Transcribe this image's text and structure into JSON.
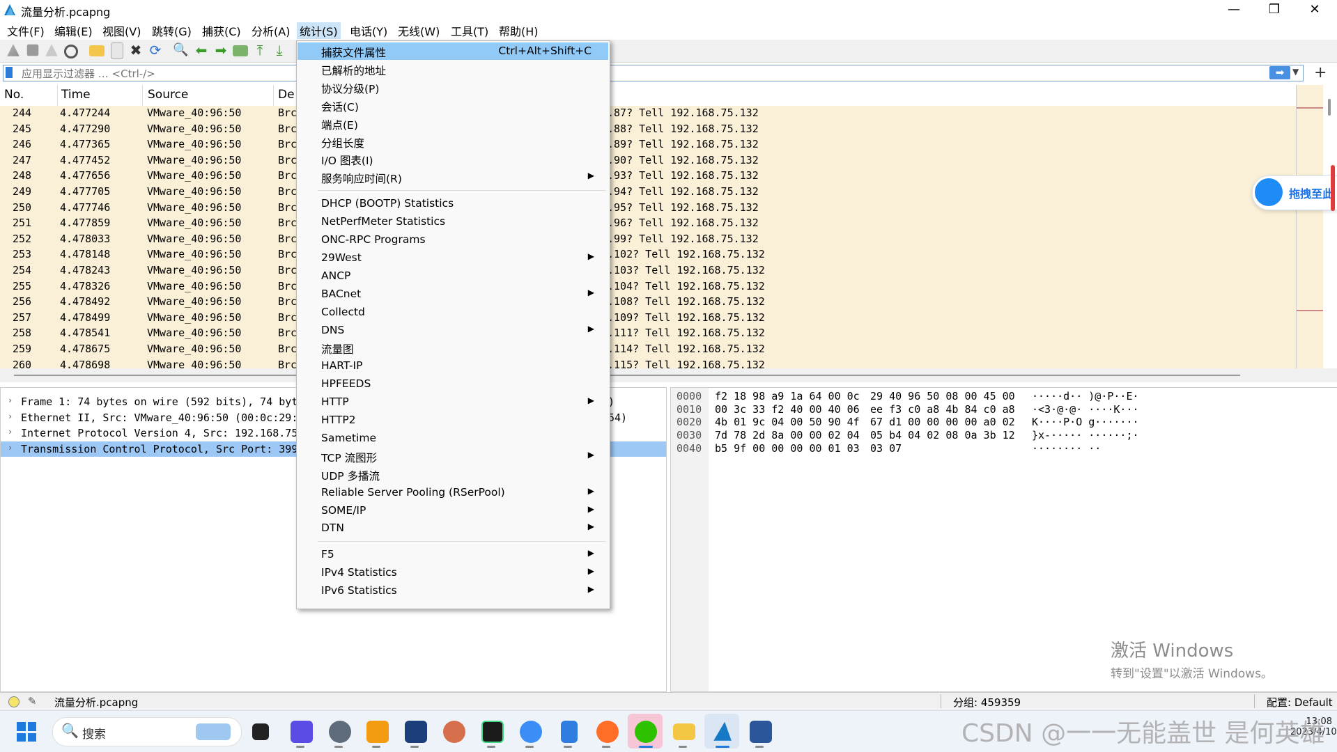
{
  "window": {
    "title": "流量分析.pcapng",
    "controls": [
      "—",
      "❐",
      "✕"
    ]
  },
  "menubar": [
    "文件(F)",
    "编辑(E)",
    "视图(V)",
    "跳转(G)",
    "捕获(C)",
    "分析(A)",
    "统计(S)",
    "电话(Y)",
    "无线(W)",
    "工具(T)",
    "帮助(H)"
  ],
  "filter": {
    "placeholder": "应用显示过滤器 … <Ctrl-/>",
    "arrow": "➡",
    "add": "+"
  },
  "columns": {
    "no": "No.",
    "time": "Time",
    "source": "Source",
    "dest": "De"
  },
  "packets": [
    {
      "no": "244",
      "time": "4.477244",
      "source": "VMware_40:96:50",
      "dest": "Brc",
      "info": ".87? Tell 192.168.75.132"
    },
    {
      "no": "245",
      "time": "4.477290",
      "source": "VMware_40:96:50",
      "dest": "Brc",
      "info": ".88? Tell 192.168.75.132"
    },
    {
      "no": "246",
      "time": "4.477365",
      "source": "VMware_40:96:50",
      "dest": "Brc",
      "info": ".89? Tell 192.168.75.132"
    },
    {
      "no": "247",
      "time": "4.477452",
      "source": "VMware_40:96:50",
      "dest": "Brc",
      "info": ".90? Tell 192.168.75.132"
    },
    {
      "no": "248",
      "time": "4.477656",
      "source": "VMware_40:96:50",
      "dest": "Brc",
      "info": ".93? Tell 192.168.75.132"
    },
    {
      "no": "249",
      "time": "4.477705",
      "source": "VMware_40:96:50",
      "dest": "Brc",
      "info": ".94? Tell 192.168.75.132"
    },
    {
      "no": "250",
      "time": "4.477746",
      "source": "VMware_40:96:50",
      "dest": "Brc",
      "info": ".95? Tell 192.168.75.132"
    },
    {
      "no": "251",
      "time": "4.477859",
      "source": "VMware_40:96:50",
      "dest": "Brc",
      "info": ".96? Tell 192.168.75.132"
    },
    {
      "no": "252",
      "time": "4.478033",
      "source": "VMware_40:96:50",
      "dest": "Brc",
      "info": ".99? Tell 192.168.75.132"
    },
    {
      "no": "253",
      "time": "4.478148",
      "source": "VMware_40:96:50",
      "dest": "Brc",
      "info": ".102? Tell 192.168.75.132"
    },
    {
      "no": "254",
      "time": "4.478243",
      "source": "VMware_40:96:50",
      "dest": "Brc",
      "info": ".103? Tell 192.168.75.132"
    },
    {
      "no": "255",
      "time": "4.478326",
      "source": "VMware_40:96:50",
      "dest": "Brc",
      "info": ".104? Tell 192.168.75.132"
    },
    {
      "no": "256",
      "time": "4.478492",
      "source": "VMware_40:96:50",
      "dest": "Brc",
      "info": ".108? Tell 192.168.75.132"
    },
    {
      "no": "257",
      "time": "4.478499",
      "source": "VMware_40:96:50",
      "dest": "Brc",
      "info": ".109? Tell 192.168.75.132"
    },
    {
      "no": "258",
      "time": "4.478541",
      "source": "VMware_40:96:50",
      "dest": "Brc",
      "info": ".111? Tell 192.168.75.132"
    },
    {
      "no": "259",
      "time": "4.478675",
      "source": "VMware_40:96:50",
      "dest": "Brc",
      "info": ".114? Tell 192.168.75.132"
    },
    {
      "no": "260",
      "time": "4.478698",
      "source": "VMware_40:96:50",
      "dest": "Brc",
      "info": ".115? Tell 192.168.75.132"
    }
  ],
  "details": [
    {
      "text": "Frame 1: 74 bytes on wire (592 bits), 74 byt",
      "tail": ")",
      "selected": false
    },
    {
      "text": "Ethernet II, Src: VMware_40:96:50 (00:0c:29:",
      "tail": "54)",
      "selected": false
    },
    {
      "text": "Internet Protocol Version 4, Src: 192.168.75",
      "tail": "",
      "selected": false
    },
    {
      "text": "Transmission Control Protocol, Src Port: 399",
      "tail": "",
      "selected": true
    }
  ],
  "bytes": [
    {
      "offset": "0000",
      "hex1": "f2 18 98 a9 1a 64 00 0c",
      "hex2": "29 40 96 50 08 00 45 00",
      "ascii": "·····d·· )@·P··E·"
    },
    {
      "offset": "0010",
      "hex1": "00 3c 33 f2 40 00 40 06",
      "hex2": "ee f3 c0 a8 4b 84 c0 a8",
      "ascii": "·<3·@·@· ····K···"
    },
    {
      "offset": "0020",
      "hex1": "4b 01 9c 04 00 50 90 4f",
      "hex2": "67 d1 00 00 00 00 a0 02",
      "ascii": "K····P·O g·······"
    },
    {
      "offset": "0030",
      "hex1": "7d 78 2d 8a 00 00 02 04",
      "hex2": "05 b4 04 02 08 0a 3b 12",
      "ascii": "}x-····· ······;·"
    },
    {
      "offset": "0040",
      "hex1": "b5 9f 00 00 00 00 01 03",
      "hex2": "03 07",
      "ascii": "········ ··"
    }
  ],
  "status": {
    "file": "流量分析.pcapng",
    "packets": "分组: 459359",
    "profile": "配置: Default"
  },
  "dropdown": {
    "items": [
      {
        "label": "捕获文件属性",
        "shortcut": "Ctrl+Alt+Shift+C",
        "sub": false,
        "hl": true,
        "y": 0
      },
      {
        "label": "已解析的地址",
        "shortcut": "",
        "sub": false,
        "hl": false,
        "y": 1
      },
      {
        "label": "协议分级(P)",
        "shortcut": "",
        "sub": false,
        "hl": false,
        "y": 2
      },
      {
        "label": "会话(C)",
        "shortcut": "",
        "sub": false,
        "hl": false,
        "y": 3
      },
      {
        "label": "端点(E)",
        "shortcut": "",
        "sub": false,
        "hl": false,
        "y": 4
      },
      {
        "label": "分组长度",
        "shortcut": "",
        "sub": false,
        "hl": false,
        "y": 5
      },
      {
        "label": "I/O 图表(I)",
        "shortcut": "",
        "sub": false,
        "hl": false,
        "y": 6
      },
      {
        "label": "服务响应时间(R)",
        "shortcut": "",
        "sub": true,
        "hl": false,
        "y": 7
      },
      {
        "label": "DHCP (BOOTP) Statistics",
        "shortcut": "",
        "sub": false,
        "hl": false,
        "y": 8
      },
      {
        "label": "NetPerfMeter Statistics",
        "shortcut": "",
        "sub": false,
        "hl": false,
        "y": 9
      },
      {
        "label": "ONC-RPC Programs",
        "shortcut": "",
        "sub": false,
        "hl": false,
        "y": 10
      },
      {
        "label": "29West",
        "shortcut": "",
        "sub": true,
        "hl": false,
        "y": 11
      },
      {
        "label": "ANCP",
        "shortcut": "",
        "sub": false,
        "hl": false,
        "y": 12
      },
      {
        "label": "BACnet",
        "shortcut": "",
        "sub": true,
        "hl": false,
        "y": 13
      },
      {
        "label": "Collectd",
        "shortcut": "",
        "sub": false,
        "hl": false,
        "y": 14
      },
      {
        "label": "DNS",
        "shortcut": "",
        "sub": true,
        "hl": false,
        "y": 15
      },
      {
        "label": "流量图",
        "shortcut": "",
        "sub": false,
        "hl": false,
        "y": 16
      },
      {
        "label": "HART-IP",
        "shortcut": "",
        "sub": false,
        "hl": false,
        "y": 17
      },
      {
        "label": "HPFEEDS",
        "shortcut": "",
        "sub": false,
        "hl": false,
        "y": 18
      },
      {
        "label": "HTTP",
        "shortcut": "",
        "sub": true,
        "hl": false,
        "y": 19
      },
      {
        "label": "HTTP2",
        "shortcut": "",
        "sub": false,
        "hl": false,
        "y": 20
      },
      {
        "label": "Sametime",
        "shortcut": "",
        "sub": false,
        "hl": false,
        "y": 21
      },
      {
        "label": "TCP 流图形",
        "shortcut": "",
        "sub": true,
        "hl": false,
        "y": 22
      },
      {
        "label": "UDP 多播流",
        "shortcut": "",
        "sub": false,
        "hl": false,
        "y": 23
      },
      {
        "label": "Reliable Server Pooling (RSerPool)",
        "shortcut": "",
        "sub": true,
        "hl": false,
        "y": 24
      },
      {
        "label": "SOME/IP",
        "shortcut": "",
        "sub": true,
        "hl": false,
        "y": 25
      },
      {
        "label": "DTN",
        "shortcut": "",
        "sub": true,
        "hl": false,
        "y": 26
      },
      {
        "label": "F5",
        "shortcut": "",
        "sub": true,
        "hl": false,
        "y": 27
      },
      {
        "label": "IPv4 Statistics",
        "shortcut": "",
        "sub": true,
        "hl": false,
        "y": 28
      },
      {
        "label": "IPv6 Statistics",
        "shortcut": "",
        "sub": true,
        "hl": false,
        "y": 29
      }
    ]
  },
  "taskbar": {
    "search": "搜索",
    "clock_time": "13:08",
    "clock_date": "2023/4/10"
  },
  "watermark": {
    "line1": "激活 Windows",
    "line2": "转到\"设置\"以激活 Windows。"
  },
  "overlay": {
    "csdn": "CSDN @一一无能盖世 是何英雄",
    "baidu": "拖拽至此"
  },
  "colors": {
    "row_bg": "#faf0d7",
    "highlight": "#91c9f7",
    "selected_detail": "#9dc8f5",
    "accent": "#1a73e8"
  }
}
